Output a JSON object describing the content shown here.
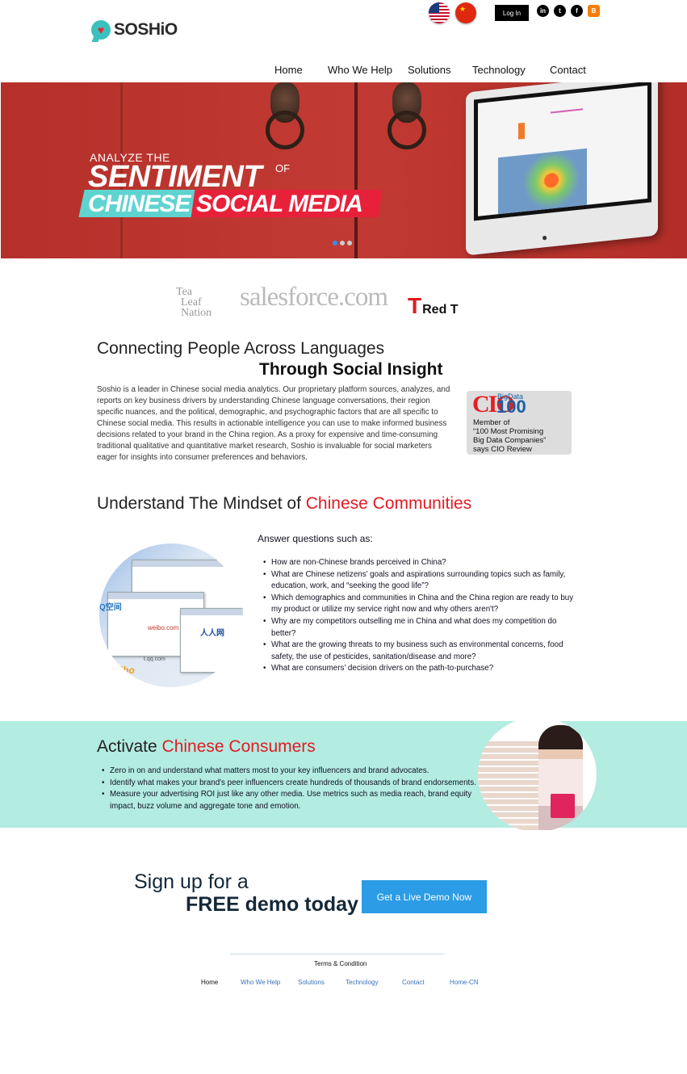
{
  "header": {
    "logo_text": "SOSHiO",
    "login_label": "Log In",
    "social": [
      {
        "name": "linkedin-icon",
        "glyph": "in"
      },
      {
        "name": "twitter-icon",
        "glyph": "t"
      },
      {
        "name": "facebook-icon",
        "glyph": "f"
      },
      {
        "name": "blogger-icon",
        "glyph": "B"
      }
    ],
    "nav": [
      "Home",
      "Who We Help",
      "Solutions",
      "Technology",
      "Contact"
    ]
  },
  "hero": {
    "line1": "ANALYZE THE",
    "line2": "SENTIMENT",
    "of": "OF",
    "word1": "CHINESE",
    "word2": "SOCIAL MEDIA"
  },
  "partners": {
    "tea_leaf": [
      "Tea",
      "Leaf",
      "Nation"
    ],
    "salesforce": "salesforce.com",
    "redt_letter": "T",
    "redt_text": "Red T"
  },
  "connect": {
    "heading": "Connecting People Across Languages",
    "subheading": "Through Social Insight",
    "body": "Soshio is a leader in Chinese social media analytics. Our proprietary platform sources, analyzes, and reports on key business drivers by understanding Chinese language conversations, their region specific nuances, and the political, demographic, and psychographic factors that are all specific to Chinese social media. This results in actionable intelligence you can use to make informed business decisions related to your brand in the China region. As a proxy for expensive and time-consuming traditional qualitative and quantitative market research, Soshio is invaluable for social marketers eager for insights into consumer preferences and behaviors.",
    "cio": {
      "logo": "CIO",
      "bigdata": "BigData",
      "hundred": "100",
      "line1": "Member of",
      "line2": "“100 Most Promising",
      "line3": "Big Data Companies”",
      "line4": "says CIO Review"
    }
  },
  "mindset": {
    "heading": "Understand The Mindset of ",
    "heading_red": "Chinese Communities",
    "answer_heading": "Answer questions such as:",
    "questions": [
      "How are non-Chinese brands perceived in China?",
      "What are Chinese netizens’ goals and aspirations surrounding topics such as family, education, work, and “seeking the good life”?",
      "Which demographics and communities in China and the China region are ready to buy my product or utilize my service right now and why others aren't?",
      "Why are my competitors outselling me in China and what does my competition do better?",
      "What are the growing threats to my business such as environmental concerns, food safety, the use of pesticides, sanitation/disease and more?",
      "What are consumers’ decision drivers on the path-to-purchase?"
    ],
    "image_text": {
      "renren": "人人网",
      "weibo": "Weibo",
      "qq": "Q空间",
      "url1": "weibo.com",
      "url2": "t.qq.com"
    }
  },
  "activate": {
    "heading": "Activate ",
    "heading_red": "Chinese Consumers",
    "items": [
      "Zero in on and understand what matters most to your key influencers and brand advocates.",
      "Identify what makes your brand's peer influencers create hundreds of thousands of brand endorsements.",
      "Measure your advertising ROI just like any other media. Use metrics such as media reach, brand equity impact, buzz volume and aggregate tone and emotion."
    ]
  },
  "cta": {
    "line1": "Sign up for a",
    "line2": "FREE demo today",
    "button": "Get a Live Demo Now"
  },
  "footer": {
    "terms": "Terms & Condition",
    "nav": [
      "Home",
      "Who We Help",
      "Solutions",
      "Technology",
      "Contact",
      "Home-CN"
    ]
  },
  "colors": {
    "accent_red": "#e21b24",
    "teal_band": "#b3ece1",
    "button_blue": "#2b9ce5"
  }
}
